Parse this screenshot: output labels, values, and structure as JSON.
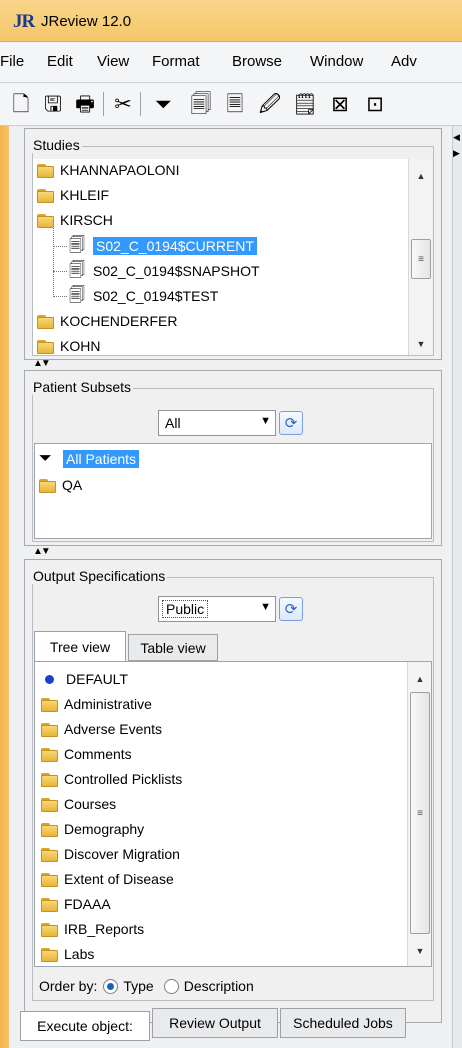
{
  "window": {
    "logo": "JR",
    "title": "JReview 12.0"
  },
  "menu": [
    "File",
    "Edit",
    "View",
    "Format",
    "Browse",
    "Window",
    "Adv"
  ],
  "toolbar_icons": [
    "new-document-icon",
    "save-icon",
    "print-icon",
    "cut-icon",
    "filter-icon",
    "database-icon",
    "report-icon",
    "edit-report-icon",
    "list-icon",
    "crosstab-icon",
    "export-icon"
  ],
  "studies": {
    "label": "Studies",
    "items": [
      {
        "text": "KHANNAPAOLONI",
        "icon": "folder-icon",
        "level": 0
      },
      {
        "text": "KHLEIF",
        "icon": "folder-icon",
        "level": 0
      },
      {
        "text": "KIRSCH",
        "icon": "folder-icon",
        "level": 0
      },
      {
        "text": "S02_C_0194$CURRENT",
        "icon": "database-icon",
        "level": 1,
        "selected": true
      },
      {
        "text": "S02_C_0194$SNAPSHOT",
        "icon": "database-icon",
        "level": 1
      },
      {
        "text": "S02_C_0194$TEST",
        "icon": "database-icon",
        "level": 1
      },
      {
        "text": "KOCHENDERFER",
        "icon": "folder-icon",
        "level": 0
      },
      {
        "text": "KOHN",
        "icon": "folder-icon",
        "level": 0
      }
    ]
  },
  "patient_subsets": {
    "label": "Patient Subsets",
    "combo_value": "All",
    "items": [
      {
        "text": "All Patients",
        "icon": "filter-icon",
        "selected": true
      },
      {
        "text": "QA",
        "icon": "folder-icon"
      }
    ]
  },
  "output_specs": {
    "label": "Output Specifications",
    "combo_value": "Public",
    "tabs": [
      "Tree view",
      "Table view"
    ],
    "items": [
      {
        "text": "DEFAULT",
        "icon": "bullet-icon"
      },
      {
        "text": "Administrative",
        "icon": "folder-icon"
      },
      {
        "text": "Adverse Events",
        "icon": "folder-icon"
      },
      {
        "text": "Comments",
        "icon": "folder-icon"
      },
      {
        "text": "Controlled Picklists",
        "icon": "folder-icon"
      },
      {
        "text": "Courses",
        "icon": "folder-icon"
      },
      {
        "text": "Demography",
        "icon": "folder-icon"
      },
      {
        "text": "Discover Migration",
        "icon": "folder-icon"
      },
      {
        "text": "Extent of Disease",
        "icon": "folder-icon"
      },
      {
        "text": "FDAAA",
        "icon": "folder-icon"
      },
      {
        "text": "IRB_Reports",
        "icon": "folder-icon"
      },
      {
        "text": "Labs",
        "icon": "folder-icon"
      }
    ],
    "order_by_label": "Order by:",
    "order_options": [
      "Type",
      "Description"
    ],
    "order_selected": "Type"
  },
  "bottom_tabs": [
    "Execute object:",
    "Review Output",
    "Scheduled Jobs"
  ]
}
